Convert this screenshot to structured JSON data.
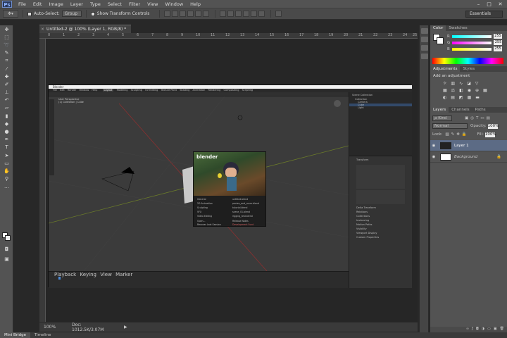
{
  "app": {
    "logo": "Ps"
  },
  "menu": [
    "File",
    "Edit",
    "Image",
    "Layer",
    "Type",
    "Select",
    "Filter",
    "View",
    "Window",
    "Help"
  ],
  "window_controls": [
    "–",
    "□",
    "✕"
  ],
  "options_bar": {
    "auto_select_label": "Auto-Select:",
    "auto_select_value": "Group",
    "show_transform_label": "Show Transform Controls"
  },
  "workspace": "Essentials",
  "document": {
    "tab_title": "Untitled-2 @ 100% (Layer 1, RGB/8) *",
    "ruler_ticks": [
      "0",
      "1",
      "2",
      "3",
      "4",
      "5",
      "6",
      "7",
      "8",
      "9",
      "10",
      "11",
      "12",
      "13",
      "14",
      "15",
      "16",
      "17",
      "18",
      "19",
      "20",
      "21",
      "22",
      "23",
      "24",
      "25"
    ]
  },
  "status": {
    "zoom": "100%",
    "doc": "Doc: 1012.5K/3.07M"
  },
  "bottom_tabs": [
    "Mini Bridge",
    "Timeline"
  ],
  "panels": {
    "color_tabs": [
      "Color",
      "Swatches"
    ],
    "color": {
      "rows": [
        {
          "label": "R",
          "value": "255"
        },
        {
          "label": "G",
          "value": "255"
        },
        {
          "label": "B",
          "value": "255"
        }
      ]
    },
    "adjust_tabs": [
      "Adjustments",
      "Styles"
    ],
    "adjust_title": "Add an adjustment",
    "layers_tabs": [
      "Layers",
      "Channels",
      "Paths"
    ],
    "kind_label": "ρ Kind",
    "blend_mode": "Normal",
    "opacity_label": "Opacity:",
    "opacity_value": "100%",
    "lock_label": "Lock:",
    "fill_label": "Fill:",
    "fill_value": "100%",
    "layers": [
      {
        "name": "Layer 1"
      },
      {
        "name": "Background"
      }
    ]
  },
  "blender": {
    "title": "Blender",
    "menu": [
      "File",
      "Edit",
      "Render",
      "Window",
      "Help"
    ],
    "workspaces": [
      "Layout",
      "Modeling",
      "Sculpting",
      "UV Editing",
      "Texture Paint",
      "Shading",
      "Animation",
      "Rendering",
      "Compositing",
      "Scripting"
    ],
    "viewport_info": [
      "User Perspective",
      "(1) Collection | Cube"
    ],
    "outliner_items": [
      "Scene Collection",
      "Collection",
      "Camera",
      "Cube",
      "Light"
    ],
    "splash_logo": "blender",
    "splash_new_file": [
      "General",
      "2D Animation",
      "Sculpting",
      "VFX",
      "Video Editing"
    ],
    "splash_recent": [
      "untitled.blend",
      "ponies_and_more.blend",
      "tutorial.blend",
      "scene_01.blend",
      "rigging_test.blend"
    ],
    "splash_links": [
      "Open...",
      "Recover Last Session"
    ],
    "splash_links_right": [
      "Release Notes",
      "Development Fund"
    ],
    "timeline_labels": [
      "Playback",
      "Keying",
      "View",
      "Marker"
    ],
    "props_sections": [
      "Transform",
      "Delta Transform",
      "Relations",
      "Collections",
      "Instancing",
      "Motion Paths",
      "Visibility",
      "Viewport Display",
      "Custom Properties"
    ]
  },
  "colors": {
    "accent": "#6e8dcc",
    "ui_dark": "#282828",
    "panel": "#535353"
  }
}
